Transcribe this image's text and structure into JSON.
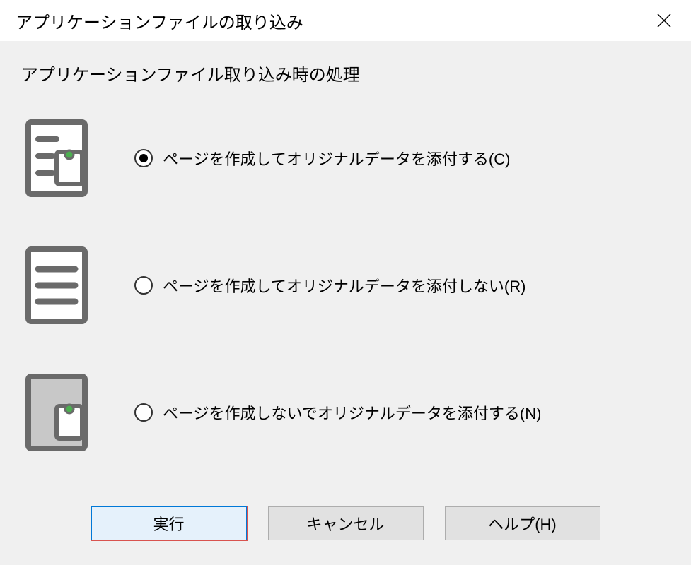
{
  "window": {
    "title": "アプリケーションファイルの取り込み"
  },
  "subtitle": "アプリケーションファイル取り込み時の処理",
  "options": [
    {
      "label": "ページを作成してオリジナルデータを添付する(C)",
      "selected": true
    },
    {
      "label": "ページを作成してオリジナルデータを添付しない(R)",
      "selected": false
    },
    {
      "label": "ページを作成しないでオリジナルデータを添付する(N)",
      "selected": false
    }
  ],
  "buttons": {
    "execute": "実行",
    "cancel": "キャンセル",
    "help": "ヘルプ(H)"
  }
}
